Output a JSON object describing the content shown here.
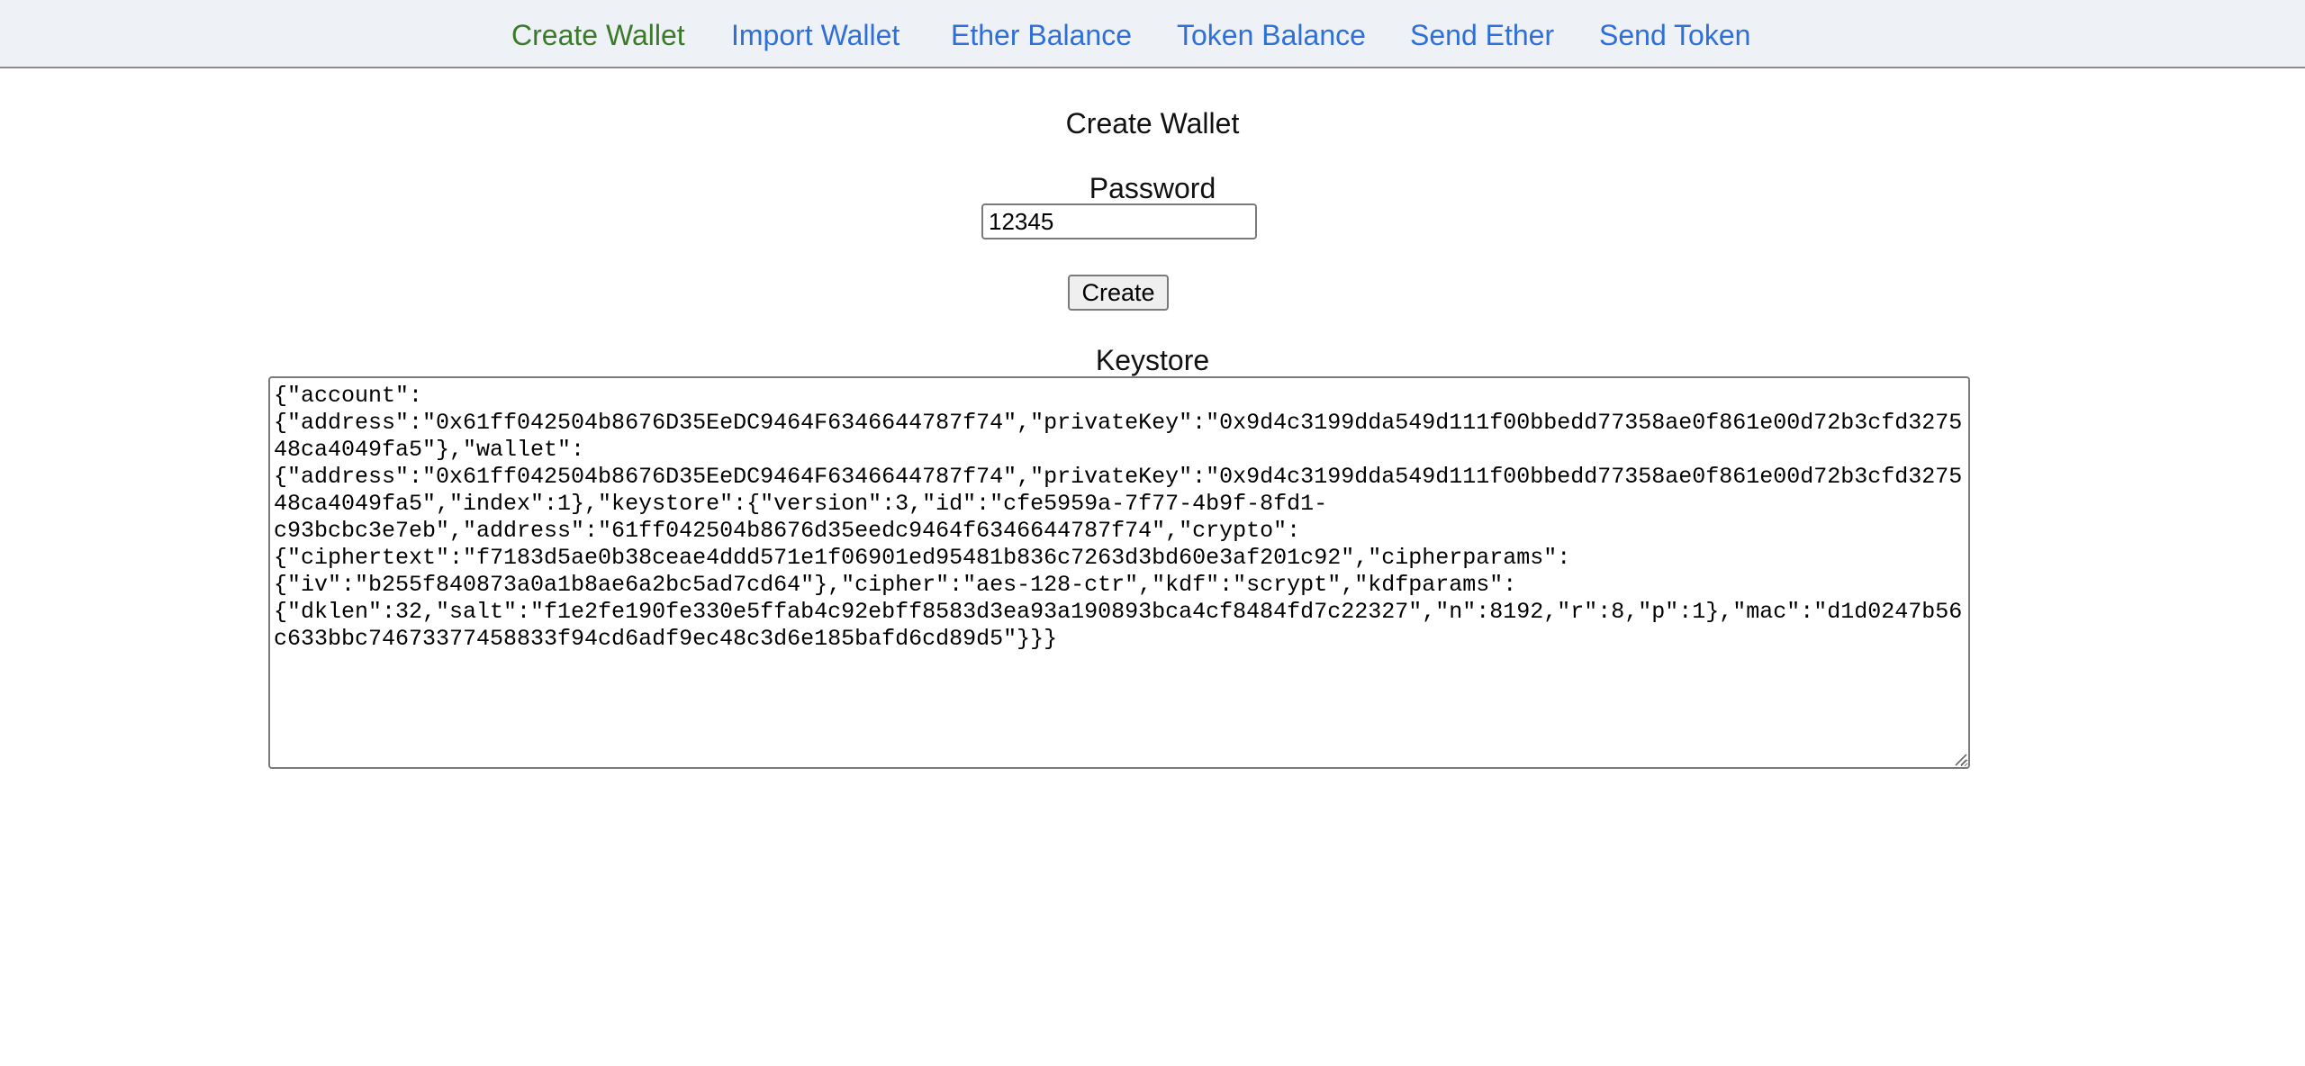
{
  "nav": {
    "items": [
      {
        "label": "Create Wallet",
        "active": true
      },
      {
        "label": "Import Wallet",
        "active": false
      },
      {
        "label": "Ether Balance",
        "active": false
      },
      {
        "label": "Token Balance",
        "active": false
      },
      {
        "label": "Send Ether",
        "active": false
      },
      {
        "label": "Send Token",
        "active": false
      }
    ]
  },
  "page": {
    "title": "Create Wallet"
  },
  "form": {
    "password_label": "Password",
    "password_value": "12345",
    "create_label": "Create",
    "keystore_label": "Keystore",
    "keystore_value": "{\"account\":\n{\"address\":\"0x61ff042504b8676D35EeDC9464F6346644787f74\",\"privateKey\":\"0x9d4c3199dda549d111f00bbedd77358ae0f861e00d72b3cfd327548ca4049fa5\"},\"wallet\":\n{\"address\":\"0x61ff042504b8676D35EeDC9464F6346644787f74\",\"privateKey\":\"0x9d4c3199dda549d111f00bbedd77358ae0f861e00d72b3cfd327548ca4049fa5\",\"index\":1},\"keystore\":{\"version\":3,\"id\":\"cfe5959a-7f77-4b9f-8fd1-\nc93bcbc3e7eb\",\"address\":\"61ff042504b8676d35eedc9464f6346644787f74\",\"crypto\":\n{\"ciphertext\":\"f7183d5ae0b38ceae4ddd571e1f06901ed95481b836c7263d3bd60e3af201c92\",\"cipherparams\":\n{\"iv\":\"b255f840873a0a1b8ae6a2bc5ad7cd64\"},\"cipher\":\"aes-128-ctr\",\"kdf\":\"scrypt\",\"kdfparams\":\n{\"dklen\":32,\"salt\":\"f1e2fe190fe330e5ffab4c92ebff8583d3ea93a190893bca4cf8484fd7c22327\",\"n\":8192,\"r\":8,\"p\":1},\"mac\":\"d1d0247b56c633bbc74673377458833f94cd6adf9ec48c3d6e185bafd6cd89d5\"}}}"
  },
  "colors": {
    "nav_background": "#eef1f5",
    "link": "#2f6fd8",
    "active_link": "#3a7a2a"
  }
}
